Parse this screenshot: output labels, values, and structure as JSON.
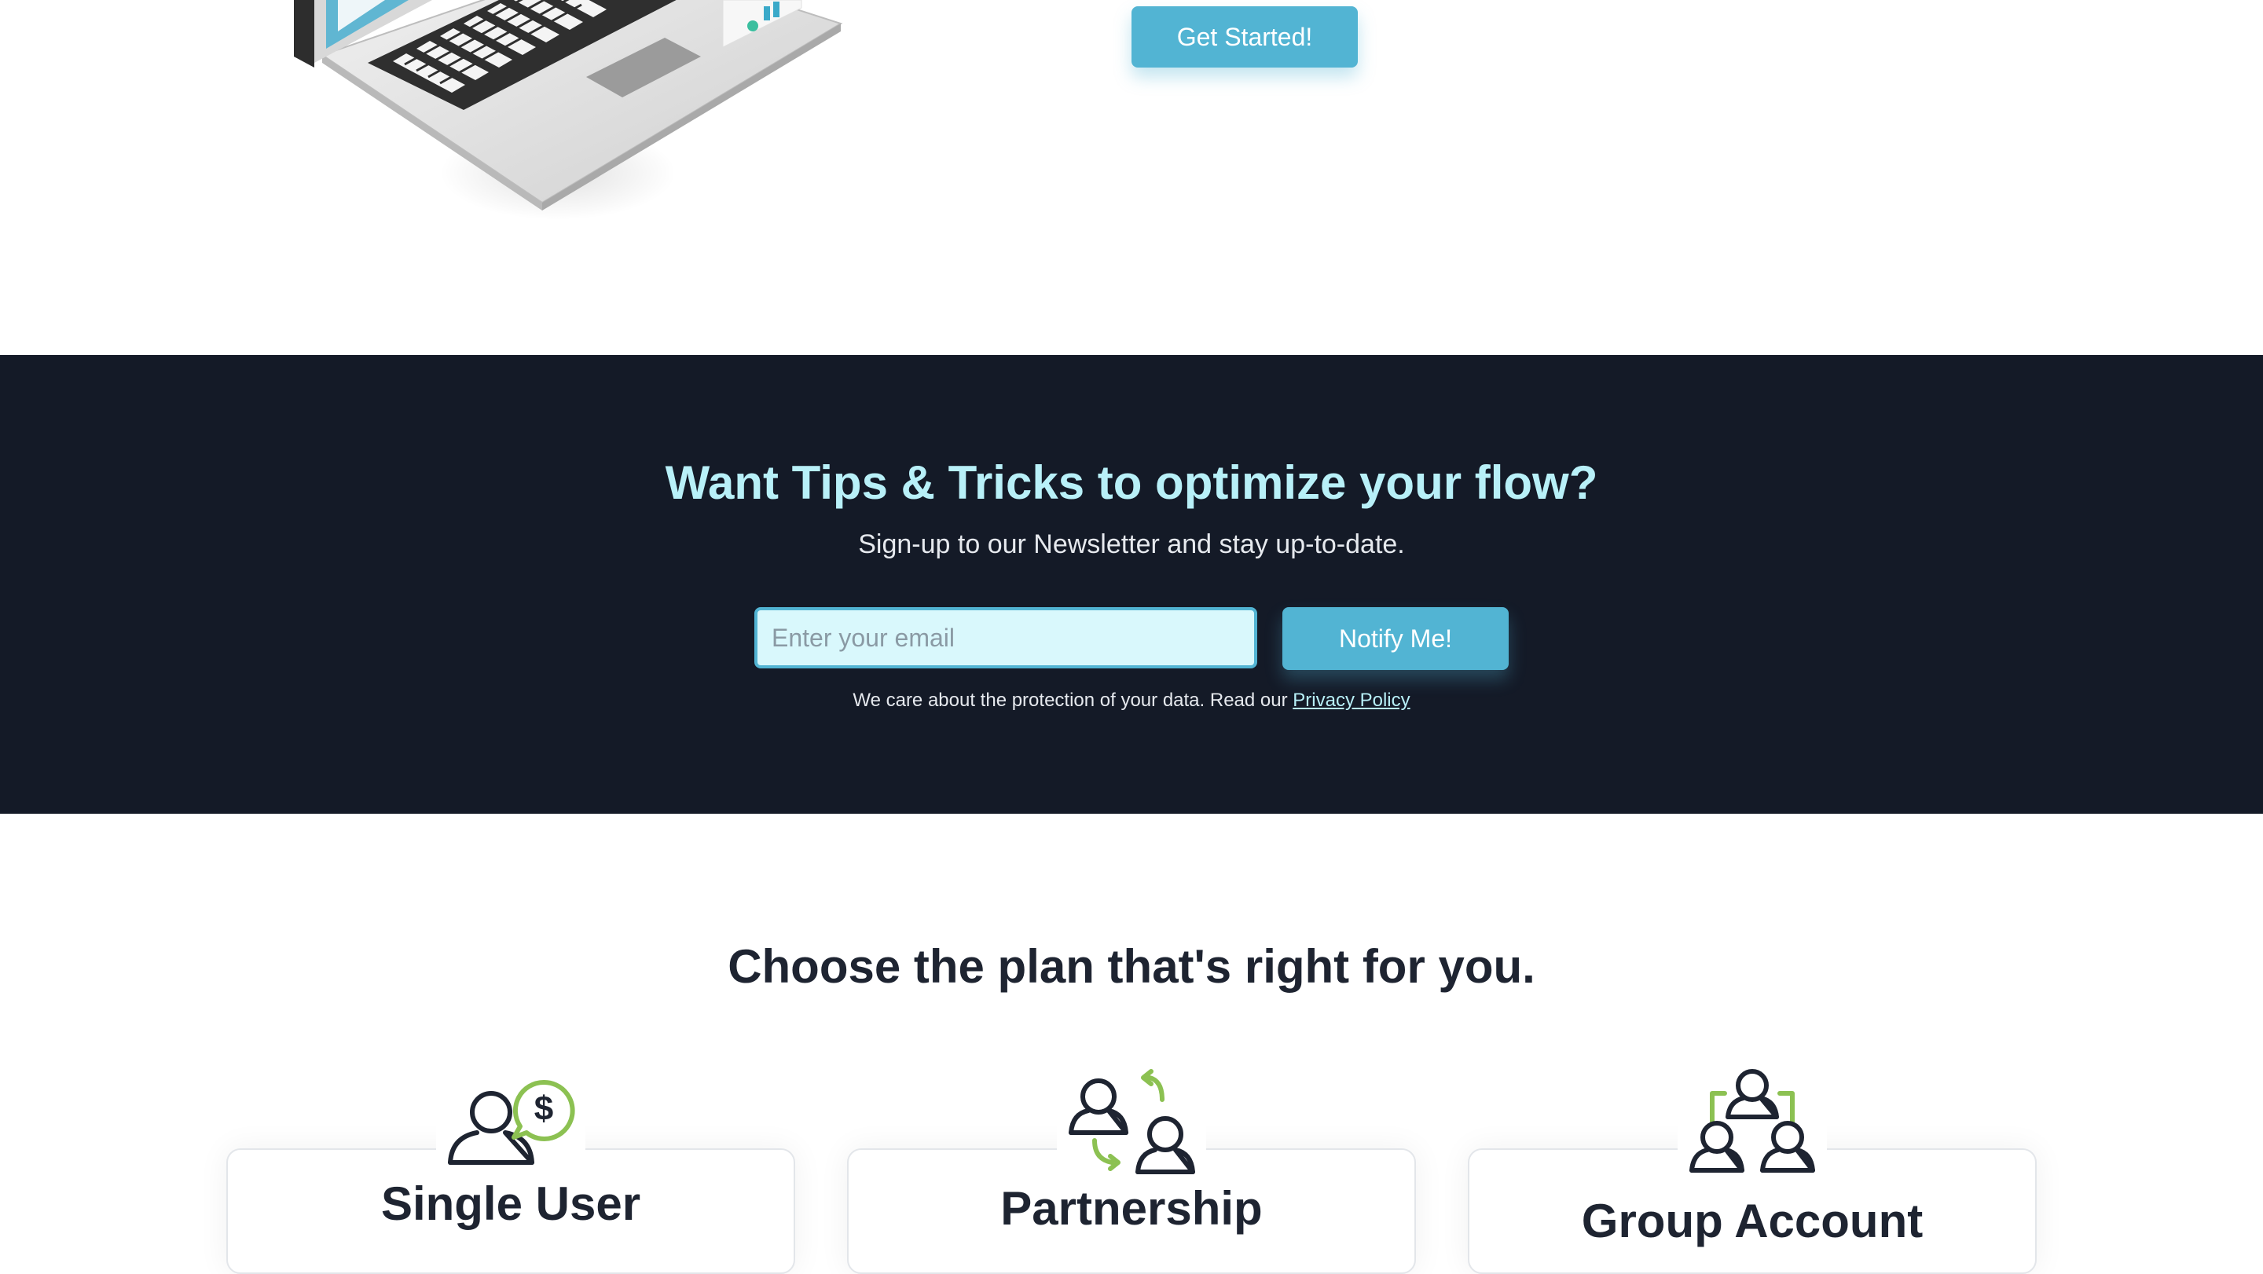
{
  "hero": {
    "cta_label": "Get Started!"
  },
  "newsletter": {
    "title": "Want Tips & Tricks to optimize your flow?",
    "subtitle": "Sign-up to our Newsletter and stay up-to-date.",
    "email_placeholder": "Enter your email",
    "email_value": "",
    "notify_label": "Notify Me!",
    "privacy_text": "We care about the protection of your data. Read our",
    "privacy_link": "Privacy Policy"
  },
  "plans": {
    "title": "Choose the plan that's right for you.",
    "items": [
      {
        "name": "Single User",
        "icon": "single-user-dollar-icon"
      },
      {
        "name": "Partnership",
        "icon": "partnership-exchange-icon"
      },
      {
        "name": "Group Account",
        "icon": "group-account-icon"
      }
    ]
  },
  "colors": {
    "accent": "#52b4d3",
    "dark_bg": "#141a27",
    "heading_light": "#b8f0f8",
    "heading_dark": "#1e2431",
    "icon_green": "#8cc152"
  }
}
